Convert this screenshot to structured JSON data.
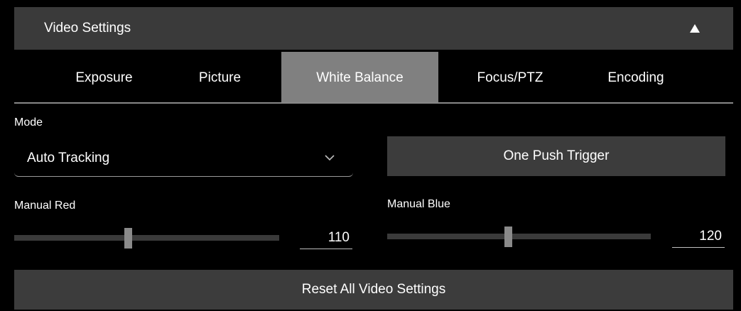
{
  "header": {
    "title": "Video Settings",
    "collapse_icon": "triangle-up-icon"
  },
  "tabs": [
    {
      "label": "Exposure",
      "active": false
    },
    {
      "label": "Picture",
      "active": false
    },
    {
      "label": "White Balance",
      "active": true
    },
    {
      "label": "Focus/PTZ",
      "active": false
    },
    {
      "label": "Encoding",
      "active": false
    }
  ],
  "mode": {
    "label": "Mode",
    "value": "Auto Tracking",
    "icon": "chevron-down-icon"
  },
  "one_push": {
    "label": "One Push Trigger"
  },
  "manual_red": {
    "label": "Manual Red",
    "value": "110",
    "level": 0.43
  },
  "manual_blue": {
    "label": "Manual Blue",
    "value": "120",
    "level": 0.46
  },
  "reset": {
    "label": "Reset All Video Settings"
  },
  "colors": {
    "background": "#000000",
    "header": "#3a3a3a",
    "active_tab": "#808080",
    "button": "#3c3c3c",
    "track": "#3a3a3a",
    "thumb": "#8a8a8a"
  }
}
